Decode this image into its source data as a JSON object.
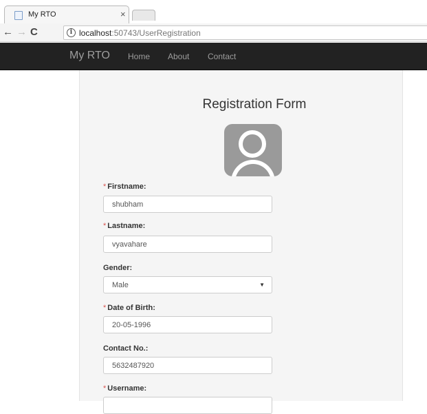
{
  "browser": {
    "tab_title": "My RTO",
    "tab_close": "×",
    "url_host": "localhost",
    "url_path": ":50743/UserRegistration",
    "info_glyph": "i",
    "back_glyph": "←",
    "forward_glyph": "→",
    "reload_glyph": "C"
  },
  "navbar": {
    "brand": "My RTO",
    "links": [
      "Home",
      "About",
      "Contact"
    ]
  },
  "form": {
    "title": "Registration Form",
    "required_mark": "*",
    "fields": [
      {
        "label": "Firstname:",
        "value": "shubham",
        "required": true
      },
      {
        "label": "Lastname:",
        "value": "vyavahare",
        "required": true
      },
      {
        "label": "Gender:",
        "value": "Male",
        "required": false
      },
      {
        "label": "Date of Birth:",
        "value": "20-05-1996",
        "required": true
      },
      {
        "label": "Contact No.:",
        "value": "5632487920",
        "required": false
      },
      {
        "label": "Username:",
        "value": "",
        "required": true
      }
    ],
    "select_caret": "▼"
  },
  "icons": {
    "avatar": "user-avatar-icon",
    "favicon": "page-favicon-icon"
  }
}
